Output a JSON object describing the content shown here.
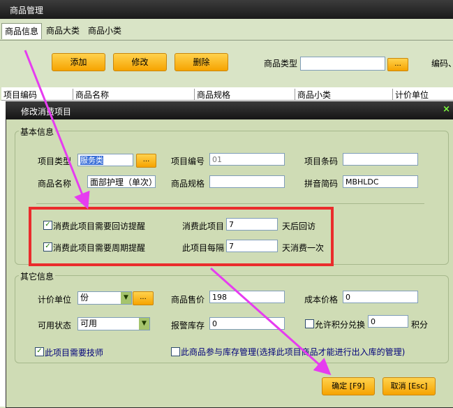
{
  "window": {
    "title": "商品管理"
  },
  "tabs": [
    "商品信息",
    "商品大类",
    "商品小类"
  ],
  "toolbar": {
    "add": "添加",
    "edit": "修改",
    "delete": "删除",
    "type_label": "商品类型",
    "type_value": "",
    "browse": "...",
    "code_label": "编码、"
  },
  "grid": {
    "columns": [
      "项目编码",
      "商品名称",
      "商品规格",
      "商品小类",
      "计价单位"
    ]
  },
  "dialog": {
    "title": "修改消费项目",
    "close": "×",
    "basic": {
      "legend": "基本信息",
      "type_label": "项目类型",
      "type_value": "服务类",
      "browse": "...",
      "code_label": "项目编号",
      "code_value": "01",
      "barcode_label": "项目条码",
      "barcode_value": "",
      "name_label": "商品名称",
      "name_value": "面部护理（单次）",
      "spec_label": "商品规格",
      "spec_value": "",
      "pinyin_label": "拼音简码",
      "pinyin_value": "MBHLDC",
      "revisit_check": "消费此项目需要回访提醒",
      "revisit_pre": "消费此项目",
      "revisit_value": "7",
      "revisit_post": "天后回访",
      "cycle_check": "消费此项目需要周期提醒",
      "cycle_pre": "此项目每隔",
      "cycle_value": "7",
      "cycle_post": "天消费一次"
    },
    "other": {
      "legend": "其它信息",
      "unit_label": "计价单位",
      "unit_value": "份",
      "browse": "...",
      "price_label": "商品售价",
      "price_value": "198",
      "cost_label": "成本价格",
      "cost_value": "0",
      "status_label": "可用状态",
      "status_value": "可用",
      "stock_label": "报警库存",
      "stock_value": "0",
      "points_check": "允许积分兑换",
      "points_value": "0",
      "points_unit": "积分",
      "tech_check": "此项目需要技师",
      "inventory_check": "此商品参与库存管理(选择此项目商品才能进行出入库的管理)"
    },
    "ok": "确定 [F9]",
    "cancel": "取消 [Esc]"
  },
  "colors": {
    "annotation_arrow": "#e63cf0",
    "highlight_box": "#ea2c2c",
    "button": "#f6a300"
  }
}
